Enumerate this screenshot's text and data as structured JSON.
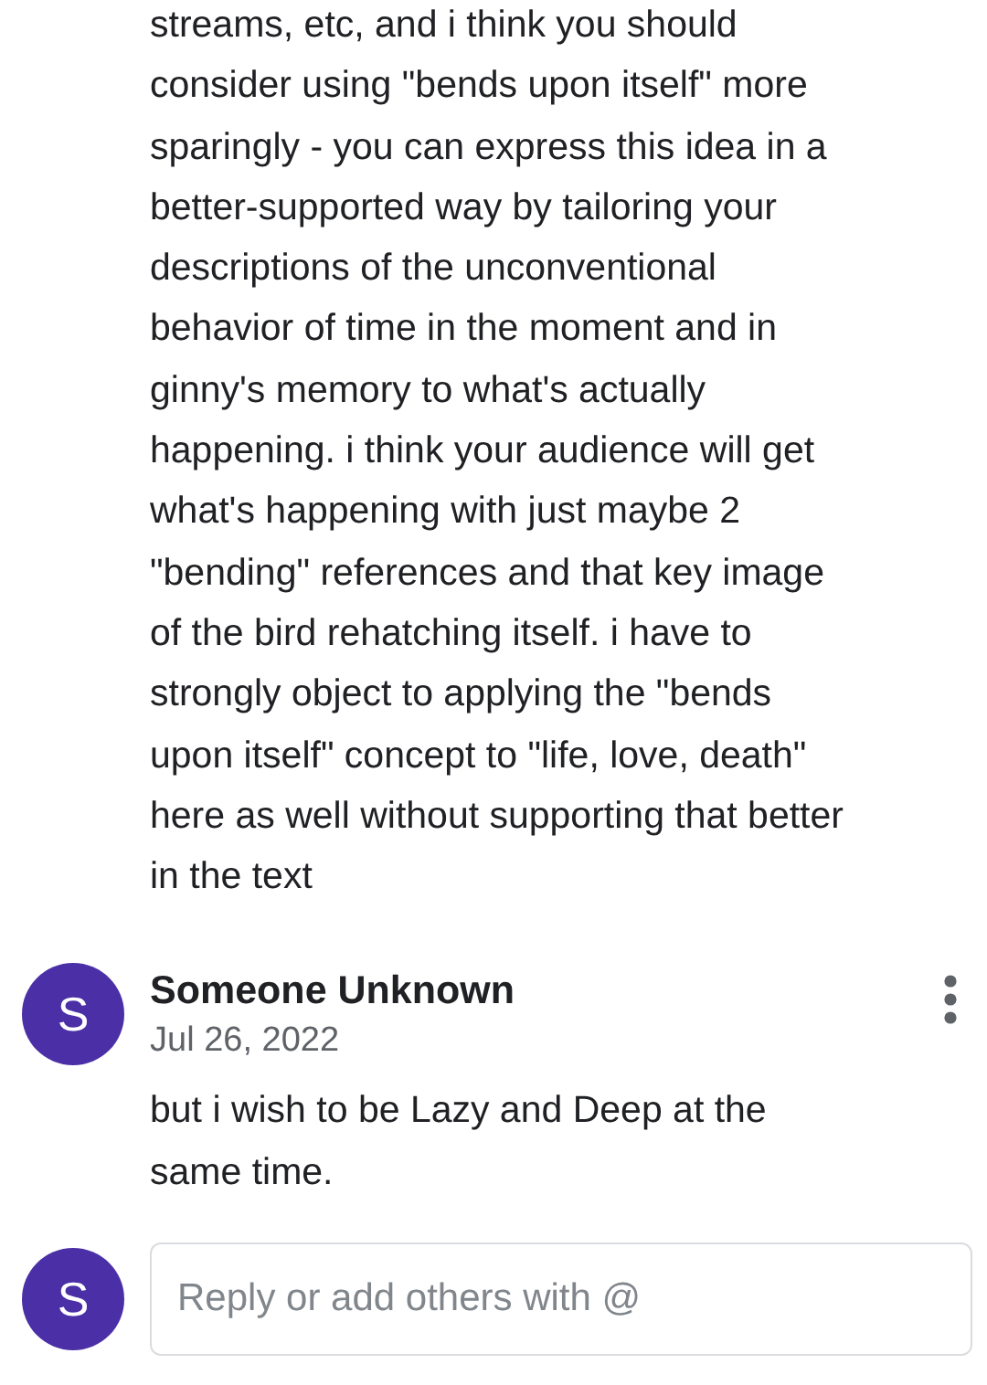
{
  "previous_comment": {
    "lines": [
      "streams, etc, and i think you should",
      "consider using \"bends upon itself\" more",
      "sparingly - you can express this idea in a",
      "better-supported way by tailoring your",
      "descriptions of the unconventional",
      "behavior of time in the moment and in",
      "ginny's memory to what's actually",
      "happening. i think your audience will get",
      "what's happening with just maybe 2",
      "\"bending\" references and that key image",
      "of the bird rehatching itself. i have to",
      "strongly object to applying the \"bends",
      "upon itself\" concept to \"life, love, death\"",
      "here as well without supporting that better",
      "in the text"
    ]
  },
  "reply": {
    "avatar": "S",
    "author": "Someone Unknown",
    "date": "Jul 26, 2022",
    "lines": [
      "but i wish to be Lazy and Deep at the",
      "same time."
    ]
  },
  "composer": {
    "avatar": "S",
    "placeholder": "Reply or add others with @"
  }
}
